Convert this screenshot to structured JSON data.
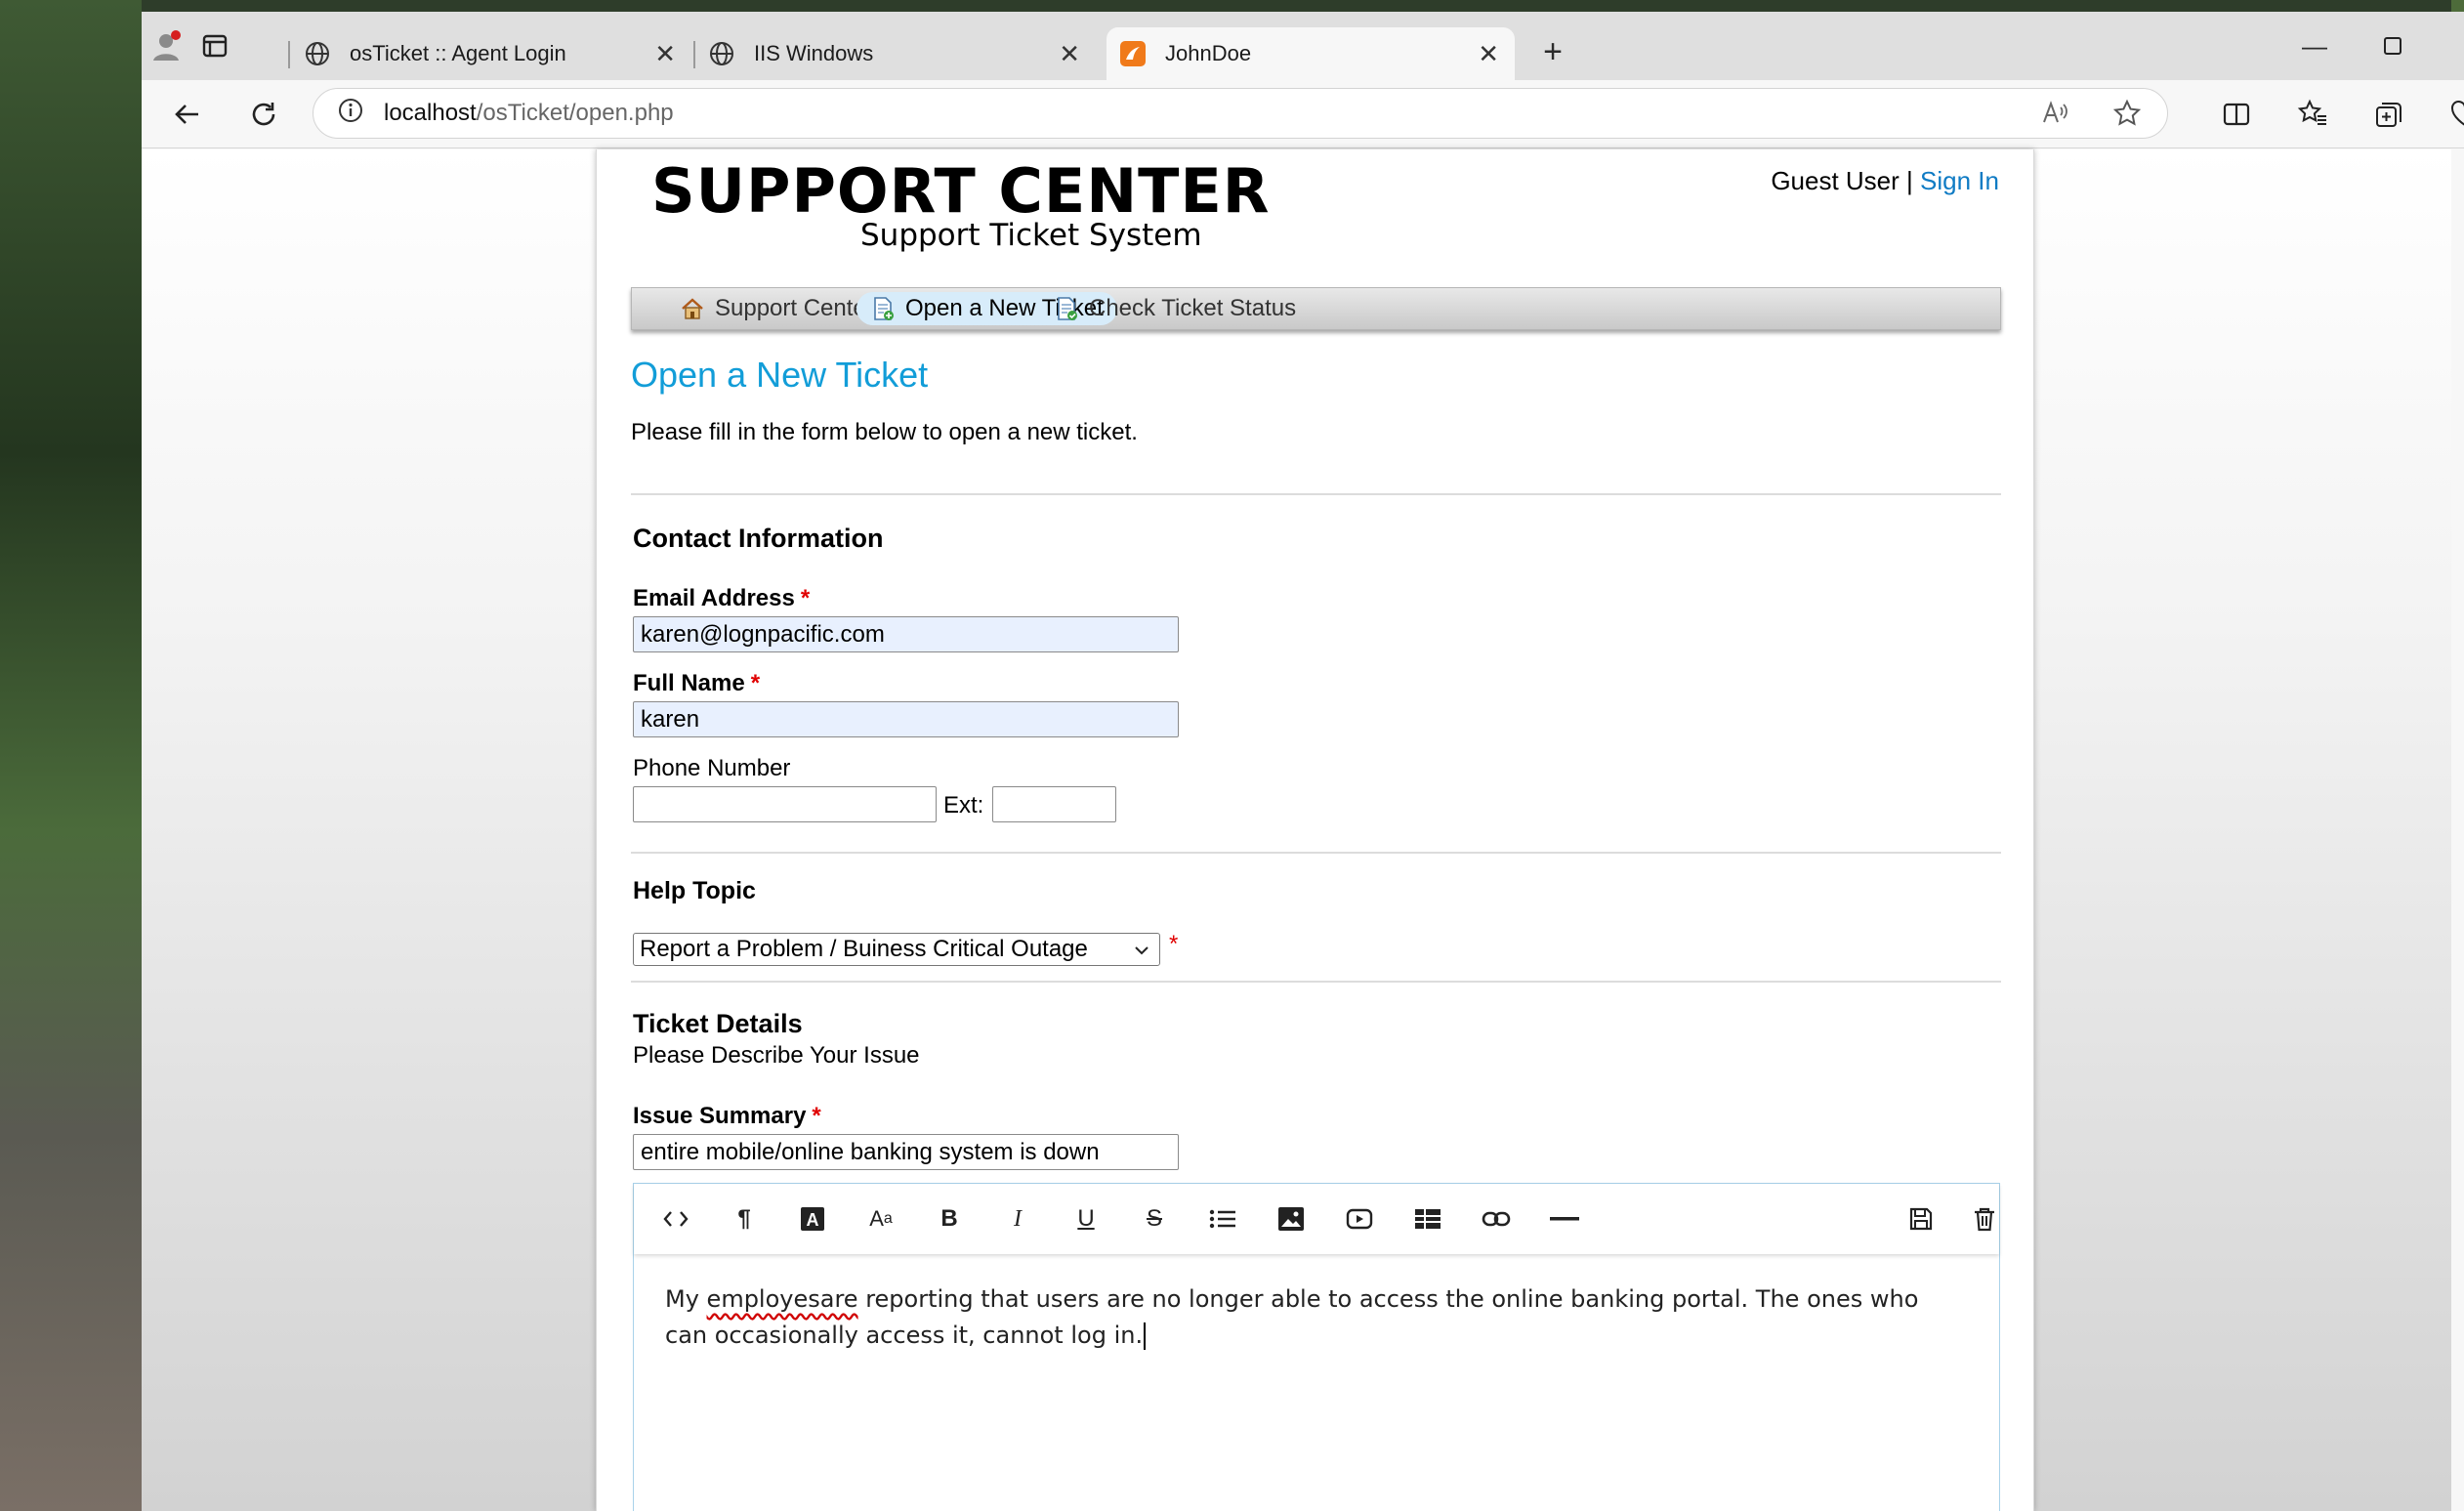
{
  "browser": {
    "tabs": [
      {
        "label": "osTicket :: Agent Login",
        "icon": "globe-icon"
      },
      {
        "label": "IIS Windows",
        "icon": "globe-icon"
      },
      {
        "label": "JohnDoe",
        "icon": "osticket-favicon"
      }
    ],
    "url_host": "localhost",
    "url_path": "/osTicket/open.php"
  },
  "site": {
    "logo_title": "SUPPORT CENTER",
    "logo_subtitle": "Support Ticket System",
    "guest_user": "Guest User",
    "separator": "|",
    "sign_in": "Sign In"
  },
  "nav": {
    "home": "Support Center Home",
    "open": "Open a New Ticket",
    "status": "Check Ticket Status"
  },
  "form": {
    "title": "Open a New Ticket",
    "intro": "Please fill in the form below to open a new ticket.",
    "contact_heading": "Contact Information",
    "email_label": "Email Address",
    "email_value": "karen@lognpacific.com",
    "name_label": "Full Name",
    "name_value": "karen",
    "phone_label": "Phone Number",
    "ext_label": "Ext:",
    "required_mark": "*",
    "help_topic_heading": "Help Topic",
    "help_topic_value": "Report a Problem / Buiness Critical Outage",
    "details_heading": "Ticket Details",
    "details_sub": "Please Describe Your Issue",
    "summary_label": "Issue Summary",
    "summary_value": "entire mobile/online banking system is down",
    "body_misspelled": "employesare",
    "body_pre": "My ",
    "body_post": " reporting that users are no longer able to access the online banking portal. The ones who",
    "body_line2": "can occasionally access it, cannot log in."
  },
  "toolbar_icons": [
    "code-icon",
    "paragraph-icon",
    "text-color-icon",
    "font-size-icon",
    "bold-icon",
    "italic-icon",
    "underline-icon",
    "strikethrough-icon",
    "list-icon",
    "image-icon",
    "video-icon",
    "table-icon",
    "link-icon",
    "horizontal-rule-icon",
    "save-draft-icon",
    "delete-draft-icon"
  ],
  "colors": {
    "accent": "#129dd8",
    "link": "#0f7bc4",
    "required": "#e00000",
    "autofill": "#e8f0fe"
  }
}
